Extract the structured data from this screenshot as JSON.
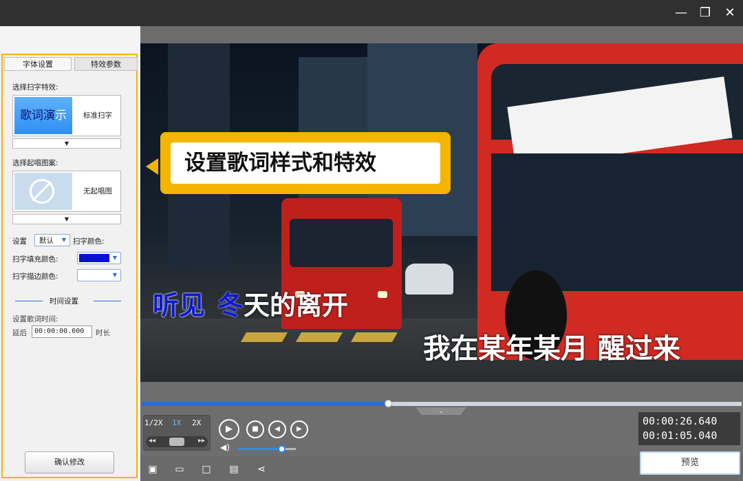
{
  "window": {
    "minimize": "—",
    "restore": "❐",
    "close": "✕"
  },
  "tabs": [
    {
      "label": "字体设置"
    },
    {
      "label": "特效参数"
    }
  ],
  "effect": {
    "label": "选择扫字特效:",
    "demo_sung": "歌词",
    "demo_partial": "演",
    "demo_unsung": "示",
    "name": "标准扫字",
    "dropdown": "▼"
  },
  "intro": {
    "label": "选择起唱图案:",
    "name": "无起唱图",
    "dropdown": "▼"
  },
  "settings": {
    "set_label": "设置",
    "preset": "默认",
    "color_label": "扫字颜色:",
    "fill_label": "扫字填充颜色:",
    "fill_color": "#0a10d0",
    "stroke_label": "扫字描边颜色:",
    "stroke_color": "#ffffff"
  },
  "timing": {
    "heading": "时间设置",
    "set_time_label": "设置歌词时间:",
    "delay_label": "延后",
    "delay_value": "00:00:00.000",
    "duration_label": "时长"
  },
  "confirm_label": "确认修改",
  "callout_text": "设置歌词样式和特效",
  "lyrics": {
    "line1_sung": "听见",
    "line1_partial_sung": "冬",
    "line1_rest": "天的离开",
    "line2": "我在某年某月 醒过来"
  },
  "player": {
    "progress": 0.41,
    "volume": 0.75,
    "speeds": [
      "1/2X",
      "1X",
      "2X"
    ],
    "active_speed": "1X",
    "current_time": "00:00:26.640",
    "total_time": "00:01:05.040",
    "preview_label": "预览"
  },
  "icons": {
    "play": "play-icon",
    "stop": "stop-icon",
    "prev": "previous-icon",
    "next": "next-icon",
    "volume": "volume-icon"
  }
}
